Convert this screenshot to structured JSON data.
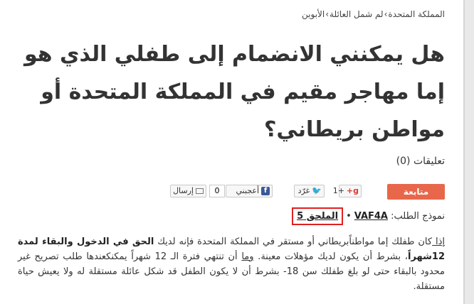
{
  "breadcrumb": {
    "items": [
      "المملكة المتحدة",
      "لم شمل العائلة",
      "الأبوين"
    ],
    "separator": "›"
  },
  "page_title": "هل يمكنني الانضمام إلى طفلي الذي هو إما مهاجر مقيم في المملكة المتحدة أو مواطن بريطاني؟",
  "comments": {
    "label": "تعليقات",
    "count": "(0)"
  },
  "social": {
    "follow_label": "متابعة",
    "gplus_label": "+1",
    "gplus_icon": "g+",
    "tweet_label": "غرّد",
    "tweet_icon": "twitter-bird-icon",
    "like_label": "أعجبني",
    "like_icon": "f",
    "like_count": "0",
    "send_label": "إرسال",
    "send_icon": "envelope-icon"
  },
  "form_ref": {
    "label": "نموذج الطلب:",
    "form_code": "VAF4A",
    "dot": "•",
    "annex": "الملحق 5"
  },
  "paragraph": {
    "p1": "إذا ",
    "p2": "كان طفلك إما مواطناًبريطاني أو مستقر في المملكة المتحدة فإنه لديك ",
    "b1": "الحق في الدخول والبقاء لمدة 12شهراً",
    "p3": "، بشرط أن يكون لديك مؤهلات معينة. ",
    "u1": "وما",
    "p4": " أن تنتهي فترة الـ 12 شهراً يمكنكعندها طلب تصريح غير محدود بالبقاء حتى لو بلغ طفلك سن 18- بشرط أن لا يكون الطفل قد شكل عائلة مستقلة له ولا يعيش حياة مستقلة."
  },
  "colors": {
    "follow_bg": "#e8674a",
    "annex_highlight": "#e02020",
    "facebook": "#3b5998",
    "twitter": "#2aa3ef",
    "gplus": "#d73d32"
  }
}
